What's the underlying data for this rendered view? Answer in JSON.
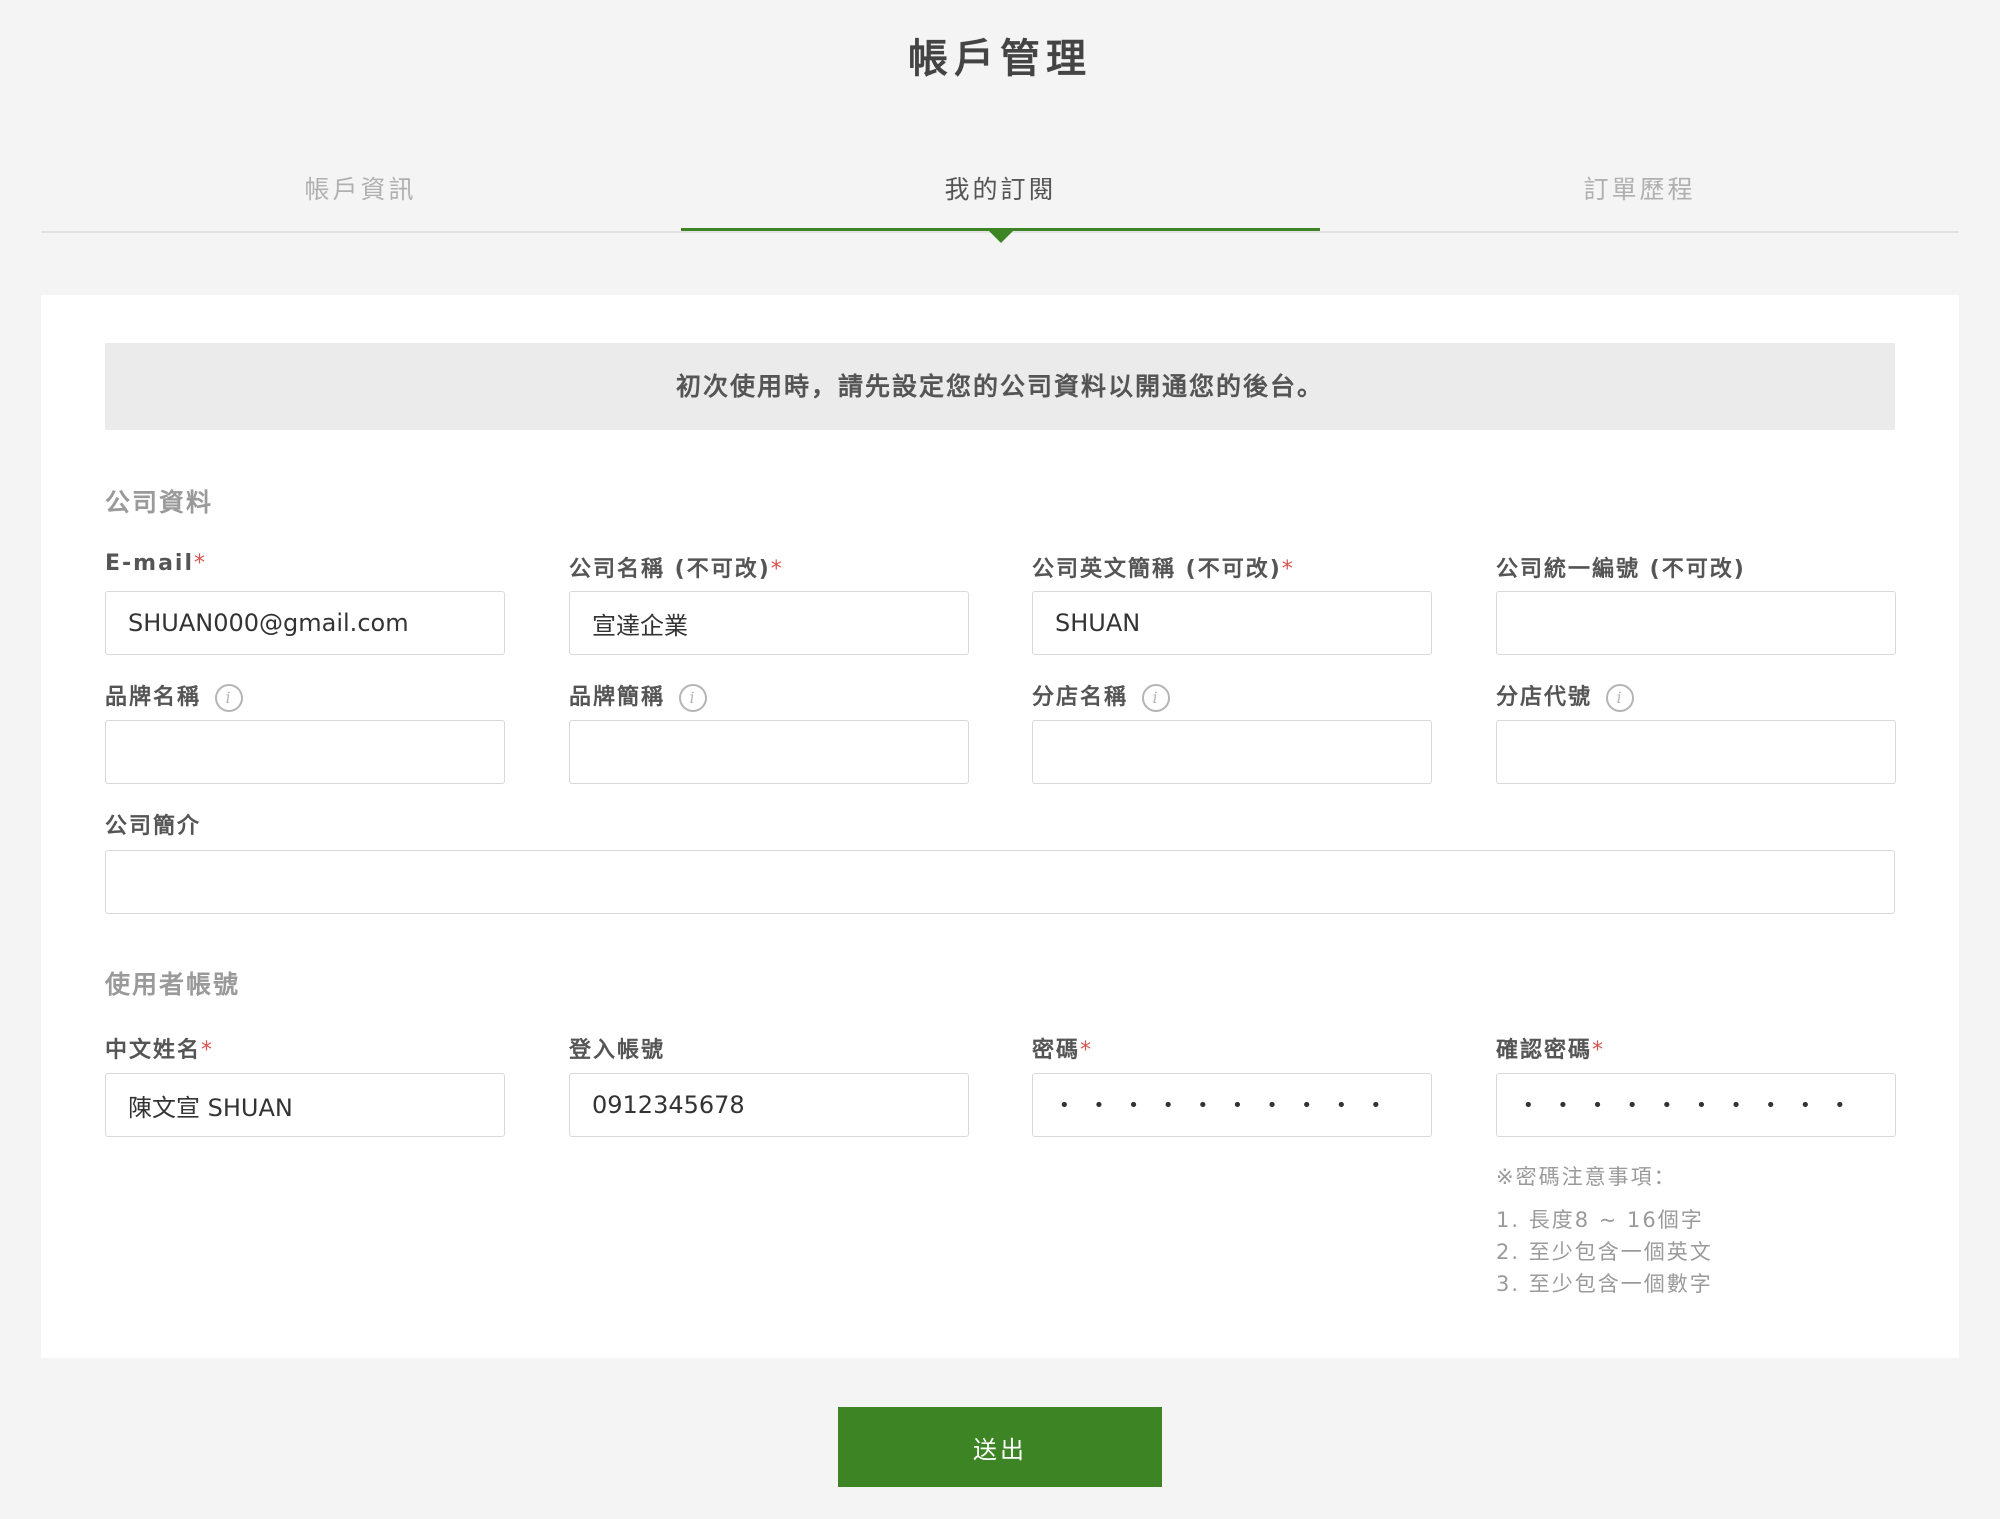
{
  "page": {
    "title": "帳戶管理"
  },
  "tabs": [
    {
      "label": "帳戶資訊",
      "active": false
    },
    {
      "label": "我的訂閱",
      "active": true
    },
    {
      "label": "訂單歷程",
      "active": false
    }
  ],
  "notice": "初次使用時，請先設定您的公司資料以開通您的後台。",
  "company": {
    "section_title": "公司資料",
    "email": {
      "label": "E-mail",
      "required": "*",
      "value": "SHUAN000@gmail.com"
    },
    "name": {
      "label": "公司名稱 (不可改)",
      "required": "*",
      "value": "宣達企業"
    },
    "en_abbr": {
      "label": "公司英文簡稱 (不可改)",
      "required": "*",
      "value": "SHUAN"
    },
    "tax_id": {
      "label": "公司統一編號 (不可改)",
      "value": ""
    },
    "brand_name": {
      "label": "品牌名稱",
      "info_icon": "i",
      "value": ""
    },
    "brand_abbr": {
      "label": "品牌簡稱",
      "info_icon": "i",
      "value": ""
    },
    "branch_name": {
      "label": "分店名稱",
      "info_icon": "i",
      "value": ""
    },
    "branch_code": {
      "label": "分店代號",
      "info_icon": "i",
      "value": ""
    },
    "intro": {
      "label": "公司簡介",
      "value": ""
    }
  },
  "user": {
    "section_title": "使用者帳號",
    "cn_name": {
      "label": "中文姓名",
      "required": "*",
      "value": "陳文宣 SHUAN"
    },
    "login": {
      "label": "登入帳號",
      "value": "0912345678"
    },
    "password": {
      "label": "密碼",
      "required": "*",
      "value": "••••••••••"
    },
    "confirm": {
      "label": "確認密碼",
      "required": "*",
      "value": "••••••••••"
    }
  },
  "password_hints": {
    "title": "※密碼注意事項：",
    "items": [
      "1. 長度8 ~ 16個字",
      "2. 至少包含一個英文",
      "3. 至少包含一個數字"
    ]
  },
  "submit_label": "送出",
  "colors": {
    "accent": "#3c8424",
    "required": "#d9534f",
    "background": "#f4f4f4",
    "notice_bg": "#ebebeb"
  }
}
